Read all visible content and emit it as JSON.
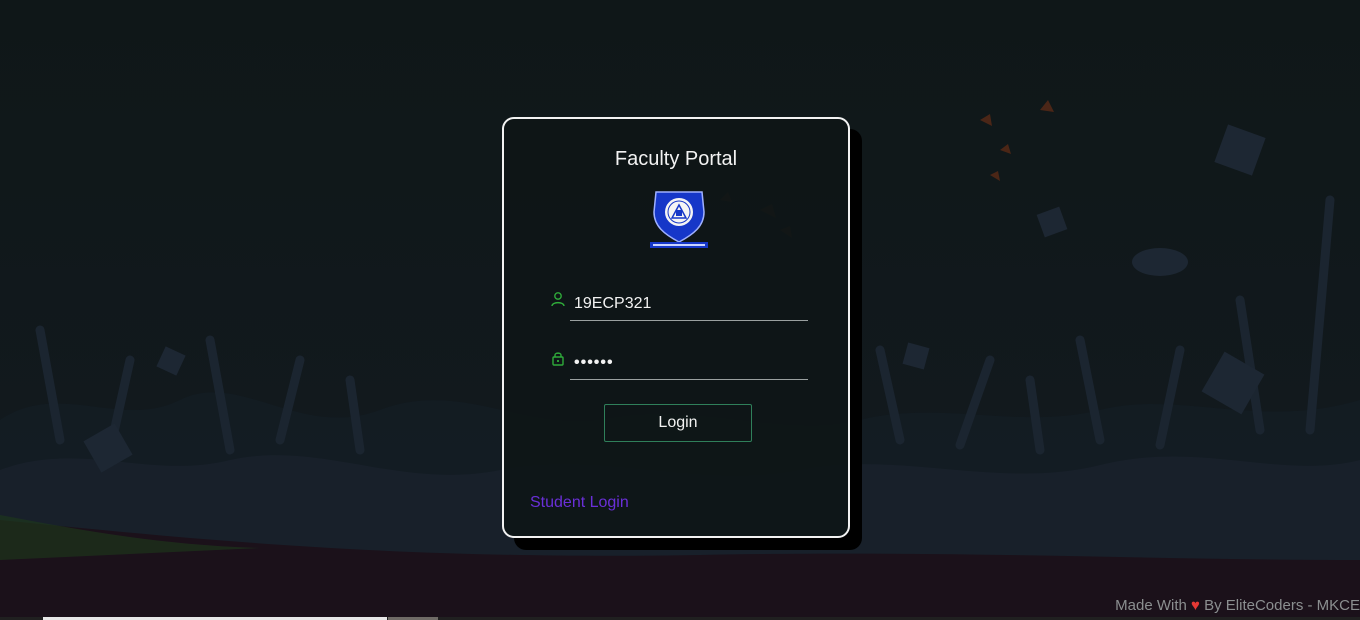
{
  "portal": {
    "title": "Faculty Portal",
    "logo_icon": "college-crest-icon"
  },
  "form": {
    "username": {
      "value": "19ECP321",
      "icon": "user-icon"
    },
    "password": {
      "value": "••••••",
      "icon": "lock-icon"
    },
    "login_label": "Login",
    "student_login_label": "Student Login"
  },
  "footer": {
    "prefix": "Made With",
    "heart": "♥",
    "suffix": "By EliteCoders - MKCE"
  },
  "colors": {
    "background": "#0f1718",
    "card_border": "#f2f2f2",
    "accent_green": "#2f7f5a",
    "icon_green": "#2faa3a",
    "link_purple": "#6a2fd8",
    "heart_red": "#e53935"
  }
}
